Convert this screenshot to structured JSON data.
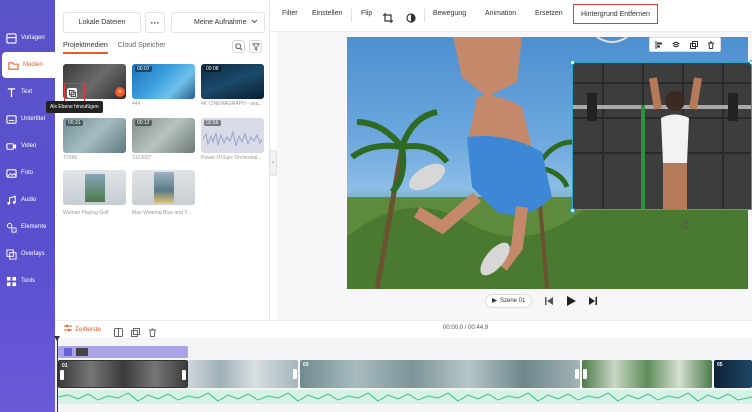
{
  "nav": {
    "items": [
      {
        "label": "Vorlagen",
        "icon": "templates-icon"
      },
      {
        "label": "Medien",
        "icon": "media-folder-icon",
        "active": true
      },
      {
        "label": "Text",
        "icon": "text-icon"
      },
      {
        "label": "Untertitel",
        "icon": "subtitles-icon"
      },
      {
        "label": "Video",
        "icon": "video-icon"
      },
      {
        "label": "Foto",
        "icon": "photo-icon"
      },
      {
        "label": "Audio",
        "icon": "audio-icon"
      },
      {
        "label": "Elemente",
        "icon": "elements-icon"
      },
      {
        "label": "Overlays",
        "icon": "overlays-icon"
      },
      {
        "label": "Tools",
        "icon": "tools-icon"
      }
    ]
  },
  "media": {
    "local_files": "Lokale Dateien",
    "more": "···",
    "album": "Meine Aufnahme",
    "tabs": [
      "Projektmedien",
      "Cloud Speicher"
    ],
    "tooltip": "Als Ebene hinzufügen",
    "items": [
      {
        "duration": "",
        "name": ""
      },
      {
        "duration": "00:07",
        "name": "444"
      },
      {
        "duration": "00:08",
        "name": "4K CINEMAGRAPH - sea..."
      },
      {
        "duration": "00:31",
        "name": "T2566"
      },
      {
        "duration": "00:12",
        "name": "3123607"
      },
      {
        "duration": "02:56",
        "name": "Power Of Epic Orchestral..."
      },
      {
        "duration": "",
        "name": "Woman Playing Golf"
      },
      {
        "duration": "",
        "name": "Man Wearing Blue and Y..."
      }
    ]
  },
  "toolbar": {
    "filter": "Filter",
    "adjust": "Einstellen",
    "flip": "Flip",
    "motion": "Bewegung",
    "animation": "Animation",
    "replace": "Ersetzen",
    "remove_bg": "Hintergrund Entfernen"
  },
  "player": {
    "scene": "Szene 01"
  },
  "timeline": {
    "storyboard": "Zeitleiste",
    "time": "00:00.0 / 00:44.9",
    "clip_numbers": [
      "01",
      "03",
      "05"
    ]
  },
  "colors": {
    "accent": "#f05a24",
    "nav_bg": "#5a4fcf",
    "highlight": "#e53935",
    "selection": "#27a6c9"
  }
}
